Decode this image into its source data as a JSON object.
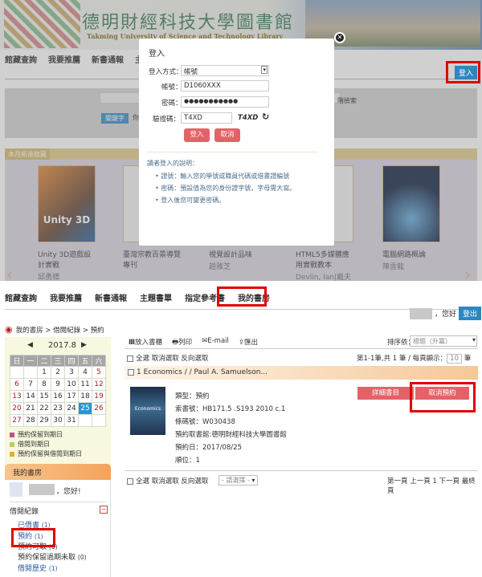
{
  "top": {
    "library_title": "德明財經科技大學圖書館",
    "library_subtitle": "Takming University of Science and Technology Library",
    "nav": [
      "館藏查詢",
      "我要推薦",
      "新書通報",
      "主"
    ],
    "login_button": "登入",
    "search_tag": "關鍵字",
    "search_fragment_left": "你",
    "search_fragment_right": "階檢索",
    "new_arrivals_label": "本月新進館藏",
    "books": [
      {
        "title": "Unity 3D遊戲設計實戰",
        "author": "邱勇標",
        "cover": "Unity 3D"
      },
      {
        "title": "臺灣宗教百景導覽專刊",
        "author": ""
      },
      {
        "title": "視覺設計品味",
        "author": "趙雅芝"
      },
      {
        "title": "HTML5多媒體應用實戰教本",
        "author": "Devlin, Ian|戴夫林 (Devlin, Ian)"
      },
      {
        "title": "電腦網路概論",
        "author": "陳雲龍"
      }
    ]
  },
  "modal": {
    "title": "登入",
    "method_label": "登入方式：",
    "method_value": "帳號",
    "account_label": "帳號：",
    "account_value": "D1060XXX",
    "password_label": "密碼：",
    "password_value": "●●●●●●●●●●●",
    "captcha_label": "驗證碼：",
    "captcha_value": "T4XD",
    "captcha_image": "T4XD",
    "login": "登入",
    "cancel": "取消",
    "help_title": "讀者登入的說明：",
    "help_items": [
      "證號：輸入您的學號或職員代碼或借書證編號",
      "密碼：預設值為您的身份證字號，字母需大寫。",
      "登入後您可變更密碼。"
    ]
  },
  "bottom": {
    "nav": [
      "館藏查詢",
      "我要推薦",
      "新書通報",
      "主題書單",
      "指定參考書",
      "我的書房"
    ],
    "greeting": "，您好",
    "logout": "登出",
    "breadcrumb": "我的書房 > 借閱紀錄 > 預約",
    "calendar": {
      "month": "2017.8",
      "weekdays": [
        "日",
        "一",
        "二",
        "三",
        "四",
        "五",
        "六"
      ],
      "weeks": [
        [
          "",
          "",
          "1",
          "2",
          "3",
          "4",
          "5"
        ],
        [
          "6",
          "7",
          "8",
          "9",
          "10",
          "11",
          "12"
        ],
        [
          "13",
          "14",
          "15",
          "16",
          "17",
          "18",
          "19"
        ],
        [
          "20",
          "21",
          "22",
          "23",
          "24",
          "25",
          "26"
        ],
        [
          "27",
          "28",
          "29",
          "30",
          "31",
          "",
          ""
        ]
      ],
      "today": "25",
      "legend": [
        {
          "label": "預約保留到期日",
          "color": "#c0508a"
        },
        {
          "label": "借閱到期日",
          "color": "#b8d060"
        },
        {
          "label": "預約保留與借閱到期日",
          "color": "#e0b020"
        }
      ]
    },
    "mylib_title": "我的書房",
    "user_greeting": "，您好!",
    "section": "借閱紀錄",
    "links": [
      {
        "label": "已借書",
        "count": "(1)"
      },
      {
        "label": "預約",
        "count": "(1)"
      },
      {
        "label": "預約可取",
        "count": "(0)"
      },
      {
        "label": "預約保留過期未取",
        "count": "(0)"
      },
      {
        "label": "借閱歷史",
        "count": "(1)"
      }
    ],
    "toolbar": {
      "shelf": "放入書櫃",
      "print": "列印",
      "email": "E-mail",
      "export": "匯出",
      "sort_label": "排序依：",
      "sort_value": "標題（升冪）"
    },
    "select_all": "全選 取消選取 反向選取",
    "paging": "第1-1筆,共 1 筆 / 每頁顯示：",
    "per_page": "10",
    "per_page_unit": "筆",
    "item": {
      "title": "1 Economics / / Paul A. Samuelson...",
      "cover": "Economics",
      "type": "類型：預約",
      "call_no": "索書號：HB171.5 .S193 2010 c.1",
      "barcode": "條碼號：W030438",
      "pickup": "預約取書館:德明財經科技大學圖書館",
      "date": "預約日：2017/08/25",
      "rank": "順位：1",
      "detail_btn": "詳細書目",
      "cancel_btn": "取消預約"
    },
    "bulk_select": "- 請選擇 -",
    "pager": "第一頁 上一頁 1 下一頁 最終頁"
  },
  "colors": {
    "accent": "#e46267",
    "blue": "#2d86c0",
    "highlight": "#e00000"
  }
}
